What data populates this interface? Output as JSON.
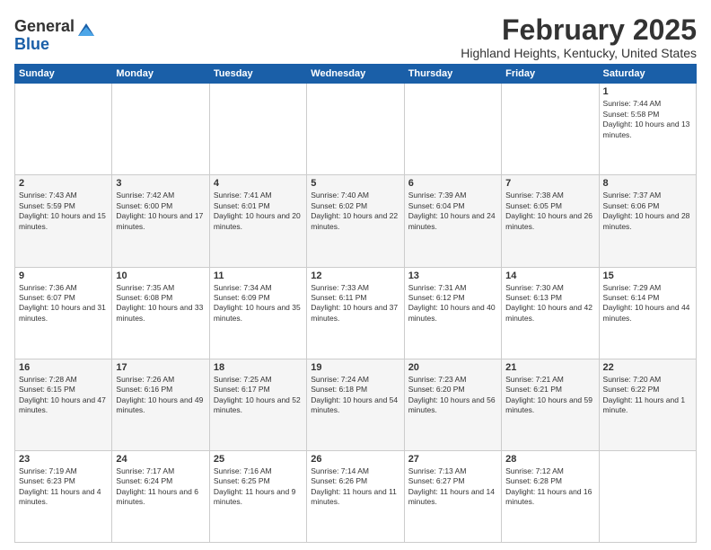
{
  "header": {
    "logo_general": "General",
    "logo_blue": "Blue",
    "month_title": "February 2025",
    "location": "Highland Heights, Kentucky, United States"
  },
  "days_of_week": [
    "Sunday",
    "Monday",
    "Tuesday",
    "Wednesday",
    "Thursday",
    "Friday",
    "Saturday"
  ],
  "weeks": [
    {
      "days": [
        {
          "num": "",
          "info": ""
        },
        {
          "num": "",
          "info": ""
        },
        {
          "num": "",
          "info": ""
        },
        {
          "num": "",
          "info": ""
        },
        {
          "num": "",
          "info": ""
        },
        {
          "num": "",
          "info": ""
        },
        {
          "num": "1",
          "info": "Sunrise: 7:44 AM\nSunset: 5:58 PM\nDaylight: 10 hours and 13 minutes."
        }
      ]
    },
    {
      "days": [
        {
          "num": "2",
          "info": "Sunrise: 7:43 AM\nSunset: 5:59 PM\nDaylight: 10 hours and 15 minutes."
        },
        {
          "num": "3",
          "info": "Sunrise: 7:42 AM\nSunset: 6:00 PM\nDaylight: 10 hours and 17 minutes."
        },
        {
          "num": "4",
          "info": "Sunrise: 7:41 AM\nSunset: 6:01 PM\nDaylight: 10 hours and 20 minutes."
        },
        {
          "num": "5",
          "info": "Sunrise: 7:40 AM\nSunset: 6:02 PM\nDaylight: 10 hours and 22 minutes."
        },
        {
          "num": "6",
          "info": "Sunrise: 7:39 AM\nSunset: 6:04 PM\nDaylight: 10 hours and 24 minutes."
        },
        {
          "num": "7",
          "info": "Sunrise: 7:38 AM\nSunset: 6:05 PM\nDaylight: 10 hours and 26 minutes."
        },
        {
          "num": "8",
          "info": "Sunrise: 7:37 AM\nSunset: 6:06 PM\nDaylight: 10 hours and 28 minutes."
        }
      ]
    },
    {
      "days": [
        {
          "num": "9",
          "info": "Sunrise: 7:36 AM\nSunset: 6:07 PM\nDaylight: 10 hours and 31 minutes."
        },
        {
          "num": "10",
          "info": "Sunrise: 7:35 AM\nSunset: 6:08 PM\nDaylight: 10 hours and 33 minutes."
        },
        {
          "num": "11",
          "info": "Sunrise: 7:34 AM\nSunset: 6:09 PM\nDaylight: 10 hours and 35 minutes."
        },
        {
          "num": "12",
          "info": "Sunrise: 7:33 AM\nSunset: 6:11 PM\nDaylight: 10 hours and 37 minutes."
        },
        {
          "num": "13",
          "info": "Sunrise: 7:31 AM\nSunset: 6:12 PM\nDaylight: 10 hours and 40 minutes."
        },
        {
          "num": "14",
          "info": "Sunrise: 7:30 AM\nSunset: 6:13 PM\nDaylight: 10 hours and 42 minutes."
        },
        {
          "num": "15",
          "info": "Sunrise: 7:29 AM\nSunset: 6:14 PM\nDaylight: 10 hours and 44 minutes."
        }
      ]
    },
    {
      "days": [
        {
          "num": "16",
          "info": "Sunrise: 7:28 AM\nSunset: 6:15 PM\nDaylight: 10 hours and 47 minutes."
        },
        {
          "num": "17",
          "info": "Sunrise: 7:26 AM\nSunset: 6:16 PM\nDaylight: 10 hours and 49 minutes."
        },
        {
          "num": "18",
          "info": "Sunrise: 7:25 AM\nSunset: 6:17 PM\nDaylight: 10 hours and 52 minutes."
        },
        {
          "num": "19",
          "info": "Sunrise: 7:24 AM\nSunset: 6:18 PM\nDaylight: 10 hours and 54 minutes."
        },
        {
          "num": "20",
          "info": "Sunrise: 7:23 AM\nSunset: 6:20 PM\nDaylight: 10 hours and 56 minutes."
        },
        {
          "num": "21",
          "info": "Sunrise: 7:21 AM\nSunset: 6:21 PM\nDaylight: 10 hours and 59 minutes."
        },
        {
          "num": "22",
          "info": "Sunrise: 7:20 AM\nSunset: 6:22 PM\nDaylight: 11 hours and 1 minute."
        }
      ]
    },
    {
      "days": [
        {
          "num": "23",
          "info": "Sunrise: 7:19 AM\nSunset: 6:23 PM\nDaylight: 11 hours and 4 minutes."
        },
        {
          "num": "24",
          "info": "Sunrise: 7:17 AM\nSunset: 6:24 PM\nDaylight: 11 hours and 6 minutes."
        },
        {
          "num": "25",
          "info": "Sunrise: 7:16 AM\nSunset: 6:25 PM\nDaylight: 11 hours and 9 minutes."
        },
        {
          "num": "26",
          "info": "Sunrise: 7:14 AM\nSunset: 6:26 PM\nDaylight: 11 hours and 11 minutes."
        },
        {
          "num": "27",
          "info": "Sunrise: 7:13 AM\nSunset: 6:27 PM\nDaylight: 11 hours and 14 minutes."
        },
        {
          "num": "28",
          "info": "Sunrise: 7:12 AM\nSunset: 6:28 PM\nDaylight: 11 hours and 16 minutes."
        },
        {
          "num": "",
          "info": ""
        }
      ]
    }
  ]
}
